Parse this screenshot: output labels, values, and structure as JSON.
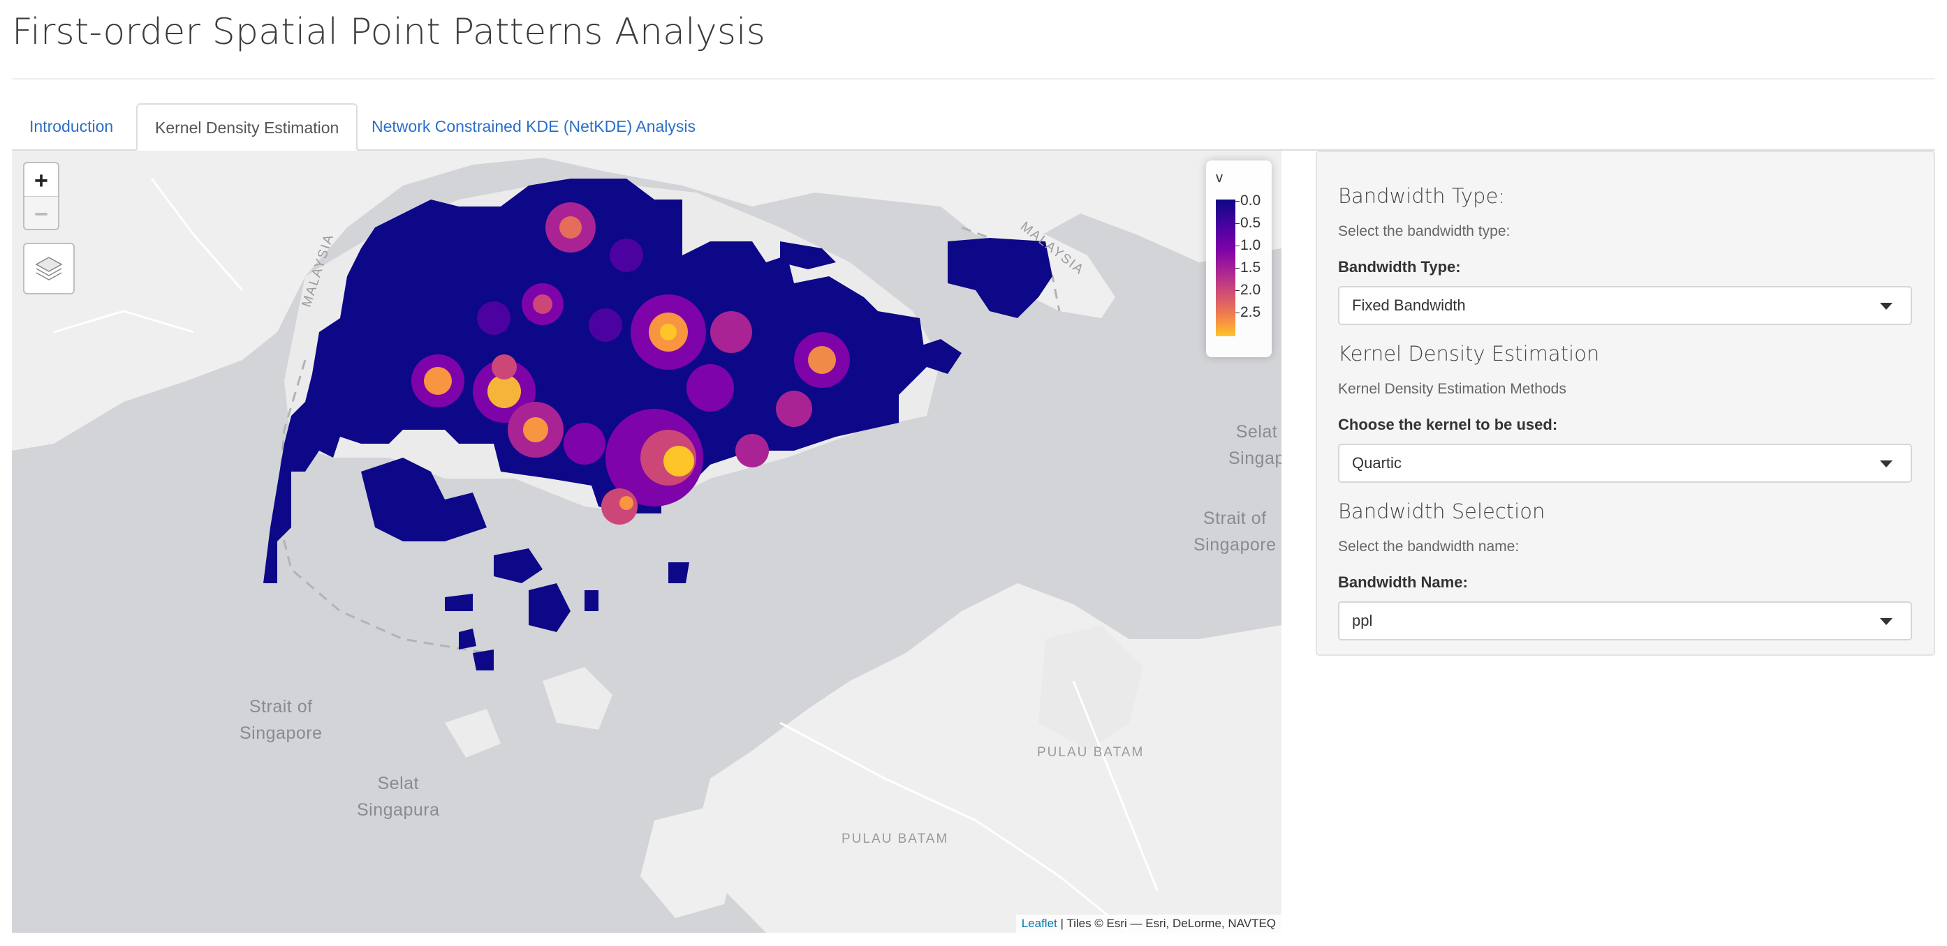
{
  "page": {
    "title": "First-order Spatial Point Patterns Analysis"
  },
  "tabs": [
    {
      "label": "Introduction",
      "active": false
    },
    {
      "label": "Kernel Density Estimation",
      "active": true
    },
    {
      "label": "Network Constrained KDE (NetKDE) Analysis",
      "active": false
    }
  ],
  "map": {
    "zoom_in": "+",
    "zoom_out": "−",
    "legend": {
      "title": "v",
      "labels": [
        "0.0",
        "0.5",
        "1.0",
        "1.5",
        "2.0",
        "2.5"
      ],
      "palette": [
        "#0d0887",
        "#7e03a8",
        "#cc4778",
        "#f89540",
        "#f0f921"
      ]
    },
    "attribution_link": "Leaflet",
    "attribution_text": "| Tiles © Esri — Esri, DeLorme, NAVTEQ",
    "labels": {
      "selat_right_1": "Selat",
      "selat_right_2": "Singap",
      "strait_right_1": "Strait of",
      "strait_right_2": "Singapore",
      "strait_left_1": "Strait of",
      "strait_left_2": "Singapore",
      "selat_left_1": "Selat",
      "selat_left_2": "Singapura",
      "pulau_batam_1": "PULAU BATAM",
      "pulau_batam_2": "PULAU BATAM",
      "malaysia_left": "MALAYSIA",
      "malaysia_right": "MALAYSIA"
    },
    "colors": {
      "water": "#d3d4d8",
      "land": "#f2f2f2",
      "kde_low": "#0d0887",
      "kde_high": "#f9d33a"
    }
  },
  "panel": {
    "bw_type_heading": "Bandwidth Type:",
    "bw_type_help": "Select the bandwidth type:",
    "bw_type_label": "Bandwidth Type:",
    "bw_type_value": "Fixed Bandwidth",
    "kde_heading": "Kernel Density Estimation",
    "kde_help": "Kernel Density Estimation Methods",
    "kernel_label": "Choose the kernel to be used:",
    "kernel_value": "Quartic",
    "bw_sel_heading": "Bandwidth Selection",
    "bw_sel_help": "Select the bandwidth name:",
    "bw_name_label": "Bandwidth Name:",
    "bw_name_value": "ppl"
  }
}
